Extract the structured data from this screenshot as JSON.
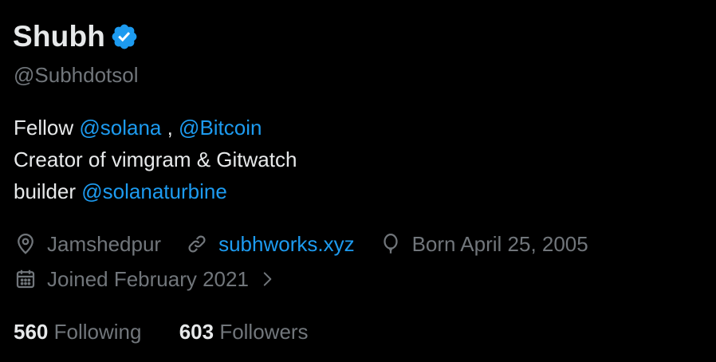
{
  "profile": {
    "display_name": "Shubh",
    "handle": "@Subhdotsol",
    "verified_icon": "verified-badge-icon"
  },
  "bio": {
    "line1_prefix": "Fellow ",
    "mention_solana": "@solana",
    "line1_sep": " , ",
    "mention_bitcoin": "@Bitcoin",
    "line2": "Creator of vimgram & Gitwatch",
    "line3_prefix": "builder ",
    "mention_turbine": "@solanaturbine"
  },
  "meta": {
    "location": "Jamshedpur",
    "website": "subhworks.xyz",
    "birthday": "Born April 25, 2005",
    "joined": "Joined February 2021",
    "icons": [
      "location-icon",
      "link-icon",
      "balloon-icon",
      "calendar-icon",
      "chevron-right-icon"
    ]
  },
  "stats": {
    "following_count": "560",
    "following_label": "Following",
    "followers_count": "603",
    "followers_label": "Followers"
  },
  "colors": {
    "background": "#000000",
    "text_primary": "#e7e9ea",
    "text_secondary": "#71767b",
    "accent": "#1d9bf0"
  }
}
